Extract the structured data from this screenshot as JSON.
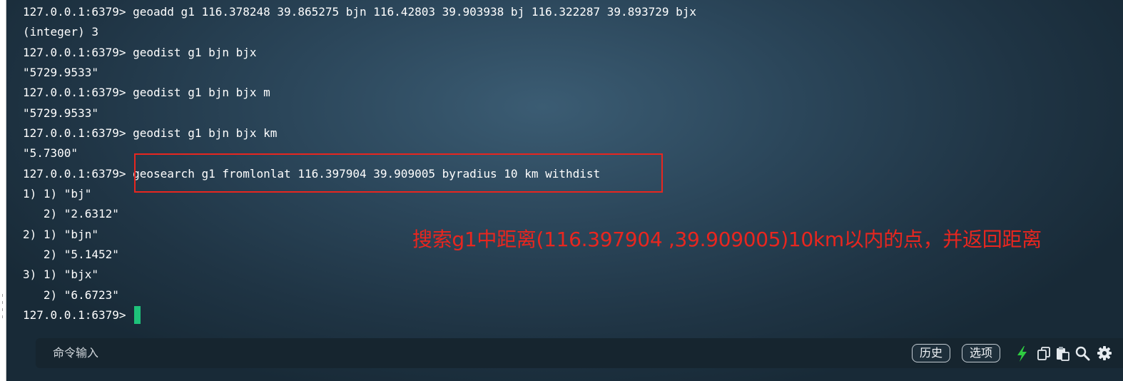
{
  "terminal": {
    "lines": [
      "127.0.0.1:6379> geoadd g1 116.378248 39.865275 bjn 116.42803 39.903938 bj 116.322287 39.893729 bjx",
      "(integer) 3",
      "127.0.0.1:6379> geodist g1 bjn bjx",
      "\"5729.9533\"",
      "127.0.0.1:6379> geodist g1 bjn bjx m",
      "\"5729.9533\"",
      "127.0.0.1:6379> geodist g1 bjn bjx km",
      "\"5.7300\"",
      "127.0.0.1:6379> geosearch g1 fromlonlat 116.397904 39.909005 byradius 10 km withdist",
      "1) 1) \"bj\"",
      "   2) \"2.6312\"",
      "2) 1) \"bjn\"",
      "   2) \"5.1452\"",
      "3) 1) \"bjx\"",
      "   2) \"6.6723\""
    ],
    "prompt": "127.0.0.1:6379> "
  },
  "annotation": {
    "text": "搜索g1中距离(116.397904 ,39.909005)10km以内的点，并返回距离",
    "color": "#e8261f"
  },
  "command_bar": {
    "placeholder": "命令输入",
    "history_label": "历史",
    "options_label": "选项",
    "icons": [
      "lightning-icon",
      "copy-icon",
      "paste-icon",
      "search-icon",
      "gear-icon"
    ]
  },
  "colors": {
    "cursor": "#1ec27a",
    "lightning": "#2ecc40",
    "highlight": "#e8261f"
  }
}
